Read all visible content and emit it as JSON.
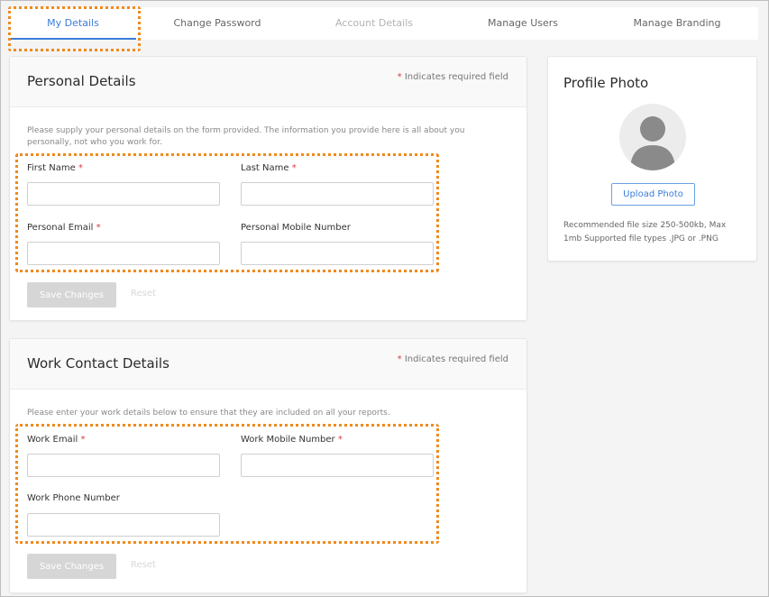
{
  "tabs": [
    {
      "label": "My Details",
      "state": "active"
    },
    {
      "label": "Change Password",
      "state": "normal"
    },
    {
      "label": "Account Details",
      "state": "disabled"
    },
    {
      "label": "Manage Users",
      "state": "normal"
    },
    {
      "label": "Manage Branding",
      "state": "normal"
    }
  ],
  "personal": {
    "title": "Personal Details",
    "required_star": "*",
    "required_note": " Indicates required field",
    "intro": "Please supply your personal details on the form provided. The information you provide here is all about you personally, not who you work for.",
    "first_name_label": "First Name",
    "last_name_label": "Last Name",
    "email_label": "Personal Email",
    "mobile_label": "Personal Mobile Number",
    "first_name_value": "",
    "last_name_value": "",
    "email_value": "",
    "mobile_value": "",
    "save_label": "Save Changes",
    "reset_label": "Reset"
  },
  "work": {
    "title": "Work Contact Details",
    "required_star": "*",
    "required_note": " Indicates required field",
    "intro": "Please enter your work details below to ensure that they are included on all your reports.",
    "email_label": "Work Email",
    "mobile_label": "Work Mobile Number",
    "phone_label": "Work Phone Number",
    "email_value": "",
    "mobile_value": "",
    "phone_value": "",
    "save_label": "Save Changes",
    "reset_label": "Reset"
  },
  "profile": {
    "title": "Profile Photo",
    "upload_label": "Upload Photo",
    "note": "Recommended file size 250-500kb, Max 1mb Supported file types .JPG or .PNG"
  },
  "colors": {
    "accent": "#3b7dd8",
    "highlight": "#f08a1d",
    "required": "#d93a3a"
  }
}
